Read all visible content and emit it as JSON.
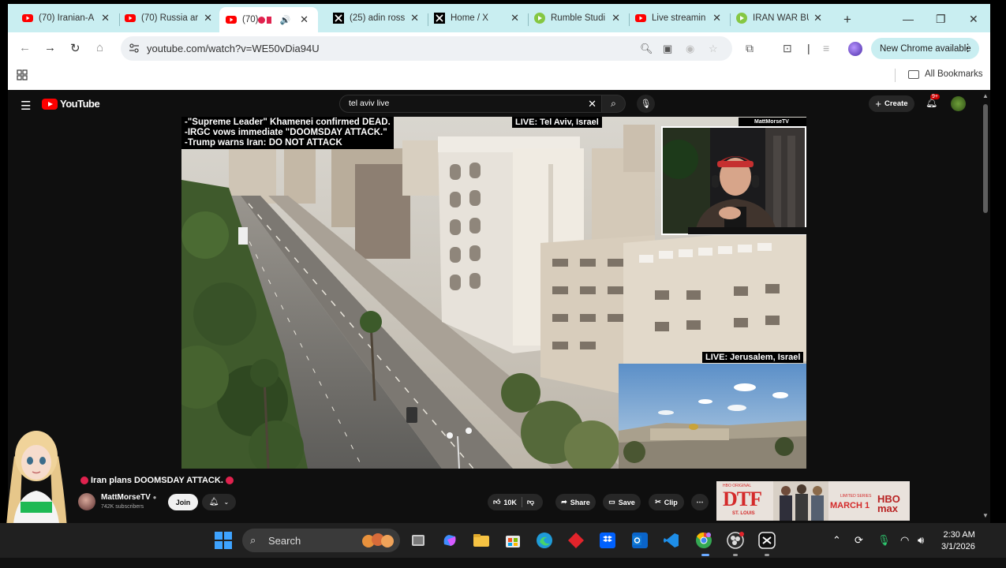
{
  "browser": {
    "tabs": [
      {
        "title": "(70) Iranian-A",
        "icon": "youtube-icon",
        "active": false
      },
      {
        "title": "(70) Russia ar",
        "icon": "youtube-icon",
        "active": false
      },
      {
        "title": "(70) ",
        "icon": "youtube-icon",
        "active": true
      },
      {
        "title": "(25) adin ross",
        "icon": "x-icon",
        "active": false
      },
      {
        "title": "Home / X",
        "icon": "x-icon",
        "active": false
      },
      {
        "title": "Rumble Studi",
        "icon": "rumble-icon",
        "active": false
      },
      {
        "title": "Live streamin",
        "icon": "youtube-icon",
        "active": false
      },
      {
        "title": "IRAN WAR BU",
        "icon": "rumble-icon",
        "active": false
      }
    ],
    "url": "youtube.com/watch?v=WE50vDia94U",
    "new_chrome_label": "New Chrome available",
    "all_bookmarks_label": "All Bookmarks"
  },
  "youtube": {
    "logo_text": "YouTube",
    "search_query": "tel aviv live",
    "create_label": "Create",
    "notification_badge": "9+",
    "video": {
      "headline_lines": [
        "-\"Supreme Leader\" Khamenei confirmed DEAD.",
        "-IRGC vows immediate \"DOOMSDAY ATTACK.\"",
        "-Trump warns Iran: DO NOT ATTACK"
      ],
      "live_label_1": "LIVE: Tel Aviv, Israel",
      "live_label_2": "LIVE: Jerusalem, Israel",
      "pip_channel": "MattMorseTV"
    },
    "title": "Iran plans DOOMSDAY ATTACK.",
    "channel_name": "MattMorseTV",
    "subscribers": "742K subscribers",
    "join_label": "Join",
    "like_count": "10K",
    "share_label": "Share",
    "save_label": "Save",
    "clip_label": "Clip",
    "ad": {
      "brand_top": "HBO ORIGINAL",
      "title": "DTF",
      "subtitle": "ST. LOUIS",
      "limited": "LIMITED SERIES",
      "date": "MARCH 1",
      "network": "HBO max"
    }
  },
  "taskbar": {
    "search_label": "Search",
    "time": "2:30 AM",
    "date": "3/1/2026"
  },
  "colors": {
    "tab_strip": "#c9eef1",
    "youtube_red": "#ff0000",
    "youtube_bg": "#0f0f0f",
    "taskbar": "#202020"
  }
}
